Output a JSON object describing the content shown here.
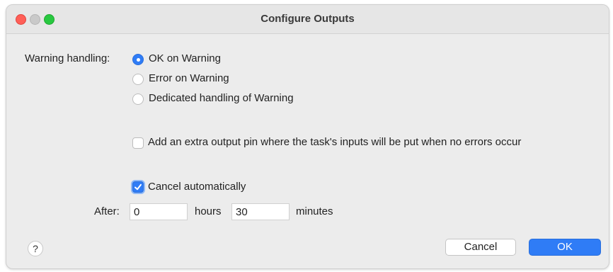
{
  "window": {
    "title": "Configure Outputs"
  },
  "warning": {
    "label": "Warning handling:",
    "options": [
      {
        "label": "OK on Warning",
        "selected": true
      },
      {
        "label": "Error on Warning",
        "selected": false
      },
      {
        "label": "Dedicated handling of Warning",
        "selected": false
      }
    ]
  },
  "extra_pin": {
    "label": "Add an extra output pin where the task's inputs will be put when no errors occur",
    "checked": false
  },
  "cancel_auto": {
    "label": "Cancel automatically",
    "checked": true
  },
  "after": {
    "label": "After:",
    "hours_value": "0",
    "hours_label": "hours",
    "minutes_value": "30",
    "minutes_label": "minutes"
  },
  "help": {
    "symbol": "?"
  },
  "buttons": {
    "cancel": "Cancel",
    "ok": "OK"
  },
  "colors": {
    "accent": "#2f7cf6",
    "close": "#ff5f57",
    "maximize": "#28c840"
  }
}
